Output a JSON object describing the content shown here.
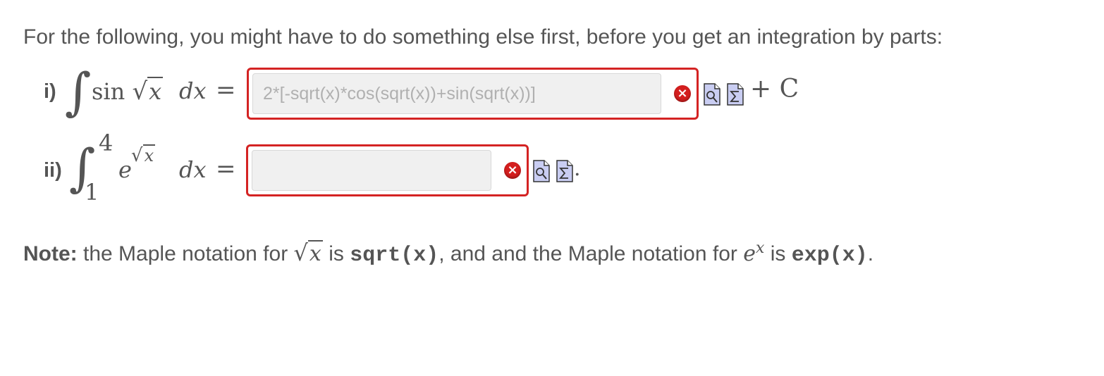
{
  "instructions": "For the following, you might have to do something else first, before you get an integration by parts:",
  "problems": [
    {
      "label": "i)",
      "integrand_func": "sin",
      "integrand_var": "x",
      "differential": "dx",
      "equals": "=",
      "answer_value": "2*[-sqrt(x)*cos(sqrt(x))+sin(sqrt(x))]",
      "suffix": "+ C",
      "status": "incorrect",
      "status_color": "#d42323"
    },
    {
      "label": "ii)",
      "lower_limit": "1",
      "upper_limit": "4",
      "base": "e",
      "exponent_var": "x",
      "differential": "dx",
      "equals": "=",
      "answer_value": "",
      "suffix": ".",
      "status": "incorrect",
      "status_color": "#d42323"
    }
  ],
  "icons": {
    "error": "close-circle-icon",
    "preview": "preview-document-icon",
    "equation_editor": "equation-editor-icon"
  },
  "note": {
    "lead": "Note:",
    "part1": "the Maple notation for",
    "sqrt_var": "x",
    "is1": "is",
    "code1": "sqrt(x)",
    "part2": ", and and the Maple notation for",
    "exp_base": "e",
    "exp_var": "x",
    "is2": "is",
    "code2": "exp(x)",
    "end": "."
  }
}
